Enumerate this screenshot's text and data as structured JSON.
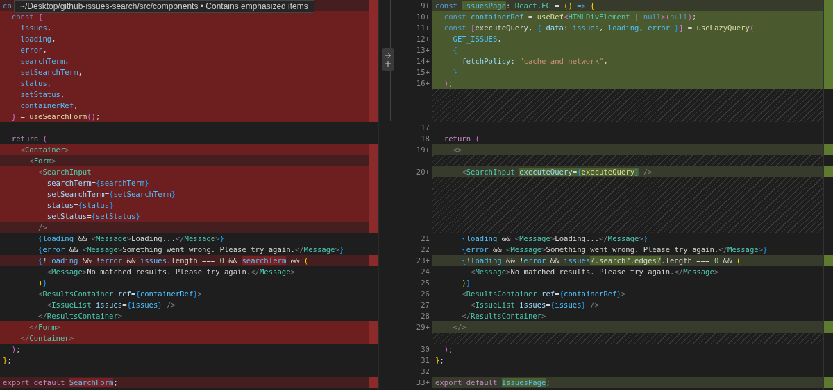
{
  "tooltip": {
    "text": "~/Desktop/github-issues-search/src/components • Contains emphasized items"
  },
  "left_pane": {
    "rows": [
      {
        "kind": "removed-dim",
        "segments": [
          {
            "kind": "keyword",
            "text": "co"
          }
        ]
      },
      {
        "kind": "removed",
        "segments": [
          {
            "kind": "keyword",
            "text": "  const "
          },
          {
            "kind": "pink",
            "text": "{"
          }
        ]
      },
      {
        "kind": "removed",
        "segments": [
          {
            "kind": "variable",
            "text": "    issues"
          },
          {
            "kind": "plain",
            "text": ","
          }
        ]
      },
      {
        "kind": "removed",
        "segments": [
          {
            "kind": "variable",
            "text": "    loading"
          },
          {
            "kind": "plain",
            "text": ","
          }
        ]
      },
      {
        "kind": "removed",
        "segments": [
          {
            "kind": "variable",
            "text": "    error"
          },
          {
            "kind": "plain",
            "text": ","
          }
        ]
      },
      {
        "kind": "removed",
        "segments": [
          {
            "kind": "variable",
            "text": "    searchTerm"
          },
          {
            "kind": "plain",
            "text": ","
          }
        ]
      },
      {
        "kind": "removed",
        "segments": [
          {
            "kind": "variable",
            "text": "    setSearchTerm"
          },
          {
            "kind": "plain",
            "text": ","
          }
        ]
      },
      {
        "kind": "removed",
        "segments": [
          {
            "kind": "variable",
            "text": "    status"
          },
          {
            "kind": "plain",
            "text": ","
          }
        ]
      },
      {
        "kind": "removed",
        "segments": [
          {
            "kind": "variable",
            "text": "    setStatus"
          },
          {
            "kind": "plain",
            "text": ","
          }
        ]
      },
      {
        "kind": "removed",
        "segments": [
          {
            "kind": "variable",
            "text": "    containerRef"
          },
          {
            "kind": "plain",
            "text": ","
          }
        ]
      },
      {
        "kind": "removed",
        "segments": [
          {
            "kind": "pink",
            "text": "  }"
          },
          {
            "kind": "plain",
            "text": " = "
          },
          {
            "kind": "function",
            "text": "useSearchForm"
          },
          {
            "kind": "pink",
            "text": "()"
          },
          {
            "kind": "plain",
            "text": ";"
          }
        ]
      },
      {
        "kind": "unchanged"
      },
      {
        "kind": "unchanged",
        "segments": [
          {
            "kind": "control",
            "text": "  return "
          },
          {
            "kind": "pink",
            "text": "("
          }
        ]
      },
      {
        "kind": "removed",
        "segments": [
          {
            "kind": "angle",
            "text": "    <"
          },
          {
            "kind": "component",
            "text": "Container"
          },
          {
            "kind": "angle",
            "text": ">"
          }
        ]
      },
      {
        "kind": "removed-dim",
        "segments": [
          {
            "kind": "angle",
            "text": "      <"
          },
          {
            "kind": "component",
            "text": "Form"
          },
          {
            "kind": "angle",
            "text": ">"
          }
        ]
      },
      {
        "kind": "removed",
        "segments": [
          {
            "kind": "angle",
            "text": "        <"
          },
          {
            "kind": "component",
            "text": "SearchInput"
          }
        ]
      },
      {
        "kind": "removed",
        "segments": [
          {
            "kind": "property",
            "text": "          searchTerm"
          },
          {
            "kind": "plain",
            "text": "="
          },
          {
            "kind": "blue",
            "text": "{"
          },
          {
            "kind": "variable",
            "text": "searchTerm"
          },
          {
            "kind": "blue",
            "text": "}"
          }
        ]
      },
      {
        "kind": "removed",
        "segments": [
          {
            "kind": "property",
            "text": "          setSearchTerm"
          },
          {
            "kind": "plain",
            "text": "="
          },
          {
            "kind": "blue",
            "text": "{"
          },
          {
            "kind": "variable",
            "text": "setSearchTerm"
          },
          {
            "kind": "blue",
            "text": "}"
          }
        ]
      },
      {
        "kind": "removed",
        "segments": [
          {
            "kind": "property",
            "text": "          status"
          },
          {
            "kind": "plain",
            "text": "="
          },
          {
            "kind": "blue",
            "text": "{"
          },
          {
            "kind": "variable",
            "text": "status"
          },
          {
            "kind": "blue",
            "text": "}"
          }
        ]
      },
      {
        "kind": "removed",
        "segments": [
          {
            "kind": "property",
            "text": "          setStatus"
          },
          {
            "kind": "plain",
            "text": "="
          },
          {
            "kind": "blue",
            "text": "{"
          },
          {
            "kind": "variable",
            "text": "setStatus"
          },
          {
            "kind": "blue",
            "text": "}"
          }
        ]
      },
      {
        "kind": "removed-dim",
        "segments": [
          {
            "kind": "angle",
            "text": "        />"
          }
        ]
      },
      {
        "kind": "unchanged",
        "segments": [
          {
            "kind": "blue",
            "text": "        {"
          },
          {
            "kind": "variable",
            "text": "loading"
          },
          {
            "kind": "plain",
            "text": " && "
          },
          {
            "kind": "angle",
            "text": "<"
          },
          {
            "kind": "component",
            "text": "Message"
          },
          {
            "kind": "angle",
            "text": ">"
          },
          {
            "kind": "plain",
            "text": "Loading..."
          },
          {
            "kind": "angle",
            "text": "</"
          },
          {
            "kind": "component",
            "text": "Message"
          },
          {
            "kind": "angle",
            "text": ">"
          },
          {
            "kind": "blue",
            "text": "}"
          }
        ]
      },
      {
        "kind": "unchanged",
        "segments": [
          {
            "kind": "blue",
            "text": "        {"
          },
          {
            "kind": "variable",
            "text": "error"
          },
          {
            "kind": "plain",
            "text": " && "
          },
          {
            "kind": "angle",
            "text": "<"
          },
          {
            "kind": "component",
            "text": "Message"
          },
          {
            "kind": "angle",
            "text": ">"
          },
          {
            "kind": "plain",
            "text": "Something went wrong. Please try again."
          },
          {
            "kind": "angle",
            "text": "</"
          },
          {
            "kind": "component",
            "text": "Message"
          },
          {
            "kind": "angle",
            "text": ">"
          },
          {
            "kind": "blue",
            "text": "}"
          }
        ]
      },
      {
        "kind": "removed-dim",
        "segments": [
          {
            "kind": "blue",
            "text": "        {"
          },
          {
            "kind": "plain",
            "text": "!"
          },
          {
            "kind": "variable",
            "text": "loading"
          },
          {
            "kind": "plain",
            "text": " && !"
          },
          {
            "kind": "variable",
            "text": "error"
          },
          {
            "kind": "plain",
            "text": " && "
          },
          {
            "kind": "variable",
            "text": "issues"
          },
          {
            "kind": "plain",
            "text": ".length === "
          },
          {
            "kind": "number",
            "text": "0"
          },
          {
            "kind": "plain",
            "text": " && "
          },
          {
            "kind": "variable",
            "text": "searchTerm",
            "emphasized": true
          },
          {
            "kind": "plain",
            "text": " && "
          },
          {
            "kind": "gold",
            "text": "("
          }
        ]
      },
      {
        "kind": "unchanged",
        "segments": [
          {
            "kind": "angle",
            "text": "          <"
          },
          {
            "kind": "component",
            "text": "Message"
          },
          {
            "kind": "angle",
            "text": ">"
          },
          {
            "kind": "plain",
            "text": "No matched results. Please try again."
          },
          {
            "kind": "angle",
            "text": "</"
          },
          {
            "kind": "component",
            "text": "Message"
          },
          {
            "kind": "angle",
            "text": ">"
          }
        ]
      },
      {
        "kind": "unchanged",
        "segments": [
          {
            "kind": "gold",
            "text": "        )"
          },
          {
            "kind": "blue",
            "text": "}"
          }
        ]
      },
      {
        "kind": "unchanged",
        "segments": [
          {
            "kind": "angle",
            "text": "        <"
          },
          {
            "kind": "component",
            "text": "ResultsContainer"
          },
          {
            "kind": "property",
            "text": " ref"
          },
          {
            "kind": "plain",
            "text": "="
          },
          {
            "kind": "blue",
            "text": "{"
          },
          {
            "kind": "variable",
            "text": "containerRef"
          },
          {
            "kind": "blue",
            "text": "}"
          },
          {
            "kind": "angle",
            "text": ">"
          }
        ]
      },
      {
        "kind": "unchanged",
        "segments": [
          {
            "kind": "angle",
            "text": "          <"
          },
          {
            "kind": "component",
            "text": "IssueList"
          },
          {
            "kind": "property",
            "text": " issues"
          },
          {
            "kind": "plain",
            "text": "="
          },
          {
            "kind": "blue",
            "text": "{"
          },
          {
            "kind": "variable",
            "text": "issues"
          },
          {
            "kind": "blue",
            "text": "}"
          },
          {
            "kind": "angle",
            "text": " />"
          }
        ]
      },
      {
        "kind": "unchanged",
        "segments": [
          {
            "kind": "angle",
            "text": "        </"
          },
          {
            "kind": "component",
            "text": "ResultsContainer"
          },
          {
            "kind": "angle",
            "text": ">"
          }
        ]
      },
      {
        "kind": "removed",
        "segments": [
          {
            "kind": "angle",
            "text": "      </"
          },
          {
            "kind": "component",
            "text": "Form"
          },
          {
            "kind": "angle",
            "text": ">"
          }
        ]
      },
      {
        "kind": "removed",
        "segments": [
          {
            "kind": "angle",
            "text": "    </"
          },
          {
            "kind": "component",
            "text": "Container"
          },
          {
            "kind": "angle",
            "text": ">"
          }
        ]
      },
      {
        "kind": "unchanged",
        "segments": [
          {
            "kind": "pink",
            "text": "  )"
          },
          {
            "kind": "plain",
            "text": ";"
          }
        ]
      },
      {
        "kind": "unchanged",
        "segments": [
          {
            "kind": "gold",
            "text": "}"
          },
          {
            "kind": "plain",
            "text": ";"
          }
        ]
      },
      {
        "kind": "unchanged"
      },
      {
        "kind": "removed-dim",
        "segments": [
          {
            "kind": "control",
            "text": "export default "
          },
          {
            "kind": "variable",
            "text": "SearchForm",
            "emphasized": true
          },
          {
            "kind": "plain",
            "text": ";"
          }
        ]
      }
    ]
  },
  "right_pane": {
    "rows": [
      {
        "kind": "added-dim",
        "number": "9+",
        "segments": [
          {
            "kind": "keyword",
            "text": "const "
          },
          {
            "kind": "variable",
            "text": "IssuesPage",
            "emphasized": true
          },
          {
            "kind": "plain",
            "text": ": "
          },
          {
            "kind": "type",
            "text": "React"
          },
          {
            "kind": "plain",
            "text": "."
          },
          {
            "kind": "type",
            "text": "FC"
          },
          {
            "kind": "plain",
            "text": " = "
          },
          {
            "kind": "gold",
            "text": "() "
          },
          {
            "kind": "keyword",
            "text": "=> "
          },
          {
            "kind": "gold",
            "text": "{"
          }
        ]
      },
      {
        "kind": "added",
        "number": "10+",
        "segments": [
          {
            "kind": "keyword",
            "text": "  const "
          },
          {
            "kind": "variable",
            "text": "containerRef"
          },
          {
            "kind": "plain",
            "text": " = "
          },
          {
            "kind": "function",
            "text": "useRef"
          },
          {
            "kind": "pink",
            "text": "<"
          },
          {
            "kind": "type",
            "text": "HTMLDivElement"
          },
          {
            "kind": "plain",
            "text": " | "
          },
          {
            "kind": "keyword",
            "text": "null"
          },
          {
            "kind": "pink",
            "text": ">("
          },
          {
            "kind": "keyword",
            "text": "null"
          },
          {
            "kind": "pink",
            "text": ")"
          },
          {
            "kind": "plain",
            "text": ";"
          }
        ]
      },
      {
        "kind": "added",
        "number": "11+",
        "segments": [
          {
            "kind": "keyword",
            "text": "  const "
          },
          {
            "kind": "pink",
            "text": "["
          },
          {
            "kind": "plain",
            "text": "executeQuery, "
          },
          {
            "kind": "blue",
            "text": "{"
          },
          {
            "kind": "property",
            "text": " data"
          },
          {
            "kind": "plain",
            "text": ": "
          },
          {
            "kind": "variable",
            "text": "issues"
          },
          {
            "kind": "plain",
            "text": ", "
          },
          {
            "kind": "variable",
            "text": "loading"
          },
          {
            "kind": "plain",
            "text": ", "
          },
          {
            "kind": "variable",
            "text": "error "
          },
          {
            "kind": "blue",
            "text": "}"
          },
          {
            "kind": "pink",
            "text": "]"
          },
          {
            "kind": "plain",
            "text": " = "
          },
          {
            "kind": "function",
            "text": "useLazyQuery"
          },
          {
            "kind": "pink",
            "text": "("
          }
        ]
      },
      {
        "kind": "added",
        "number": "12+",
        "segments": [
          {
            "kind": "variable",
            "text": "    GET_ISSUES"
          },
          {
            "kind": "plain",
            "text": ","
          }
        ]
      },
      {
        "kind": "added",
        "number": "13+",
        "segments": [
          {
            "kind": "blue",
            "text": "    {"
          }
        ]
      },
      {
        "kind": "added",
        "number": "14+",
        "segments": [
          {
            "kind": "property",
            "text": "      fetchPolicy"
          },
          {
            "kind": "plain",
            "text": ": "
          },
          {
            "kind": "string",
            "text": "\"cache-and-network\""
          },
          {
            "kind": "plain",
            "text": ","
          }
        ]
      },
      {
        "kind": "added",
        "number": "15+",
        "segments": [
          {
            "kind": "blue",
            "text": "    }"
          }
        ]
      },
      {
        "kind": "added",
        "number": "16+",
        "segments": [
          {
            "kind": "pink",
            "text": "  )"
          },
          {
            "kind": "plain",
            "text": ";"
          }
        ]
      },
      {
        "kind": "filler"
      },
      {
        "kind": "filler"
      },
      {
        "kind": "filler"
      },
      {
        "kind": "unchanged",
        "number": "17"
      },
      {
        "kind": "unchanged",
        "number": "18",
        "segments": [
          {
            "kind": "control",
            "text": "  return "
          },
          {
            "kind": "pink",
            "text": "("
          }
        ]
      },
      {
        "kind": "added-dim",
        "number": "19+",
        "segments": [
          {
            "kind": "angle",
            "text": "    <>"
          }
        ]
      },
      {
        "kind": "filler"
      },
      {
        "kind": "added-dim",
        "number": "20+",
        "segments": [
          {
            "kind": "angle",
            "text": "      <"
          },
          {
            "kind": "component",
            "text": "SearchInput "
          },
          {
            "kind": "property",
            "text": "executeQuery",
            "emphasized": true
          },
          {
            "kind": "plain",
            "text": "=",
            "emphasized": true
          },
          {
            "kind": "blue",
            "text": "{",
            "emphasized": true
          },
          {
            "kind": "function",
            "text": "executeQuery",
            "emphasized": true
          },
          {
            "kind": "blue",
            "text": "}",
            "emphasized": true
          },
          {
            "kind": "angle",
            "text": " />"
          }
        ]
      },
      {
        "kind": "filler"
      },
      {
        "kind": "filler"
      },
      {
        "kind": "filler"
      },
      {
        "kind": "filler"
      },
      {
        "kind": "filler"
      },
      {
        "kind": "unchanged",
        "number": "21",
        "segments": [
          {
            "kind": "blue",
            "text": "      {"
          },
          {
            "kind": "variable",
            "text": "loading"
          },
          {
            "kind": "plain",
            "text": " && "
          },
          {
            "kind": "angle",
            "text": "<"
          },
          {
            "kind": "component",
            "text": "Message"
          },
          {
            "kind": "angle",
            "text": ">"
          },
          {
            "kind": "plain",
            "text": "Loading..."
          },
          {
            "kind": "angle",
            "text": "</"
          },
          {
            "kind": "component",
            "text": "Message"
          },
          {
            "kind": "angle",
            "text": ">"
          },
          {
            "kind": "blue",
            "text": "}"
          }
        ]
      },
      {
        "kind": "unchanged",
        "number": "22",
        "segments": [
          {
            "kind": "blue",
            "text": "      {"
          },
          {
            "kind": "variable",
            "text": "error"
          },
          {
            "kind": "plain",
            "text": " && "
          },
          {
            "kind": "angle",
            "text": "<"
          },
          {
            "kind": "component",
            "text": "Message"
          },
          {
            "kind": "angle",
            "text": ">"
          },
          {
            "kind": "plain",
            "text": "Something went wrong. Please try again."
          },
          {
            "kind": "angle",
            "text": "</"
          },
          {
            "kind": "component",
            "text": "Message"
          },
          {
            "kind": "angle",
            "text": ">"
          },
          {
            "kind": "blue",
            "text": "}"
          }
        ]
      },
      {
        "kind": "added-dim",
        "number": "23+",
        "segments": [
          {
            "kind": "blue",
            "text": "      {"
          },
          {
            "kind": "plain",
            "text": "!"
          },
          {
            "kind": "variable",
            "text": "loading"
          },
          {
            "kind": "plain",
            "text": " && !"
          },
          {
            "kind": "variable",
            "text": "error"
          },
          {
            "kind": "plain",
            "text": " && "
          },
          {
            "kind": "variable",
            "text": "issues"
          },
          {
            "kind": "plain",
            "text": "?.search?.edges?",
            "emphasized": true
          },
          {
            "kind": "plain",
            "text": ".length === "
          },
          {
            "kind": "number",
            "text": "0"
          },
          {
            "kind": "plain",
            "text": " && "
          },
          {
            "kind": "gold",
            "text": "("
          }
        ]
      },
      {
        "kind": "unchanged",
        "number": "24",
        "segments": [
          {
            "kind": "angle",
            "text": "        <"
          },
          {
            "kind": "component",
            "text": "Message"
          },
          {
            "kind": "angle",
            "text": ">"
          },
          {
            "kind": "plain",
            "text": "No matched results. Please try again."
          },
          {
            "kind": "angle",
            "text": "</"
          },
          {
            "kind": "component",
            "text": "Message"
          },
          {
            "kind": "angle",
            "text": ">"
          }
        ]
      },
      {
        "kind": "unchanged",
        "number": "25",
        "segments": [
          {
            "kind": "gold",
            "text": "      )"
          },
          {
            "kind": "blue",
            "text": "}"
          }
        ]
      },
      {
        "kind": "unchanged",
        "number": "26",
        "segments": [
          {
            "kind": "angle",
            "text": "      <"
          },
          {
            "kind": "component",
            "text": "ResultsContainer"
          },
          {
            "kind": "property",
            "text": " ref"
          },
          {
            "kind": "plain",
            "text": "="
          },
          {
            "kind": "blue",
            "text": "{"
          },
          {
            "kind": "variable",
            "text": "containerRef"
          },
          {
            "kind": "blue",
            "text": "}"
          },
          {
            "kind": "angle",
            "text": ">"
          }
        ]
      },
      {
        "kind": "unchanged",
        "number": "27",
        "segments": [
          {
            "kind": "angle",
            "text": "        <"
          },
          {
            "kind": "component",
            "text": "IssueList"
          },
          {
            "kind": "property",
            "text": " issues"
          },
          {
            "kind": "plain",
            "text": "="
          },
          {
            "kind": "blue",
            "text": "{"
          },
          {
            "kind": "variable",
            "text": "issues"
          },
          {
            "kind": "blue",
            "text": "}"
          },
          {
            "kind": "angle",
            "text": " />"
          }
        ]
      },
      {
        "kind": "unchanged",
        "number": "28",
        "segments": [
          {
            "kind": "angle",
            "text": "      </"
          },
          {
            "kind": "component",
            "text": "ResultsContainer"
          },
          {
            "kind": "angle",
            "text": ">"
          }
        ]
      },
      {
        "kind": "added-dim",
        "number": "29+",
        "segments": [
          {
            "kind": "angle",
            "text": "    </>"
          }
        ]
      },
      {
        "kind": "filler"
      },
      {
        "kind": "unchanged",
        "number": "30",
        "segments": [
          {
            "kind": "pink",
            "text": "  )"
          },
          {
            "kind": "plain",
            "text": ";"
          }
        ]
      },
      {
        "kind": "unchanged",
        "number": "31",
        "segments": [
          {
            "kind": "gold",
            "text": "}"
          },
          {
            "kind": "plain",
            "text": ";"
          }
        ]
      },
      {
        "kind": "unchanged",
        "number": "32"
      },
      {
        "kind": "added-dim",
        "number": "33+",
        "segments": [
          {
            "kind": "control",
            "text": "export default "
          },
          {
            "kind": "variable",
            "text": "IssuesPage",
            "emphasized": true
          },
          {
            "kind": "plain",
            "text": ";"
          }
        ]
      }
    ]
  }
}
